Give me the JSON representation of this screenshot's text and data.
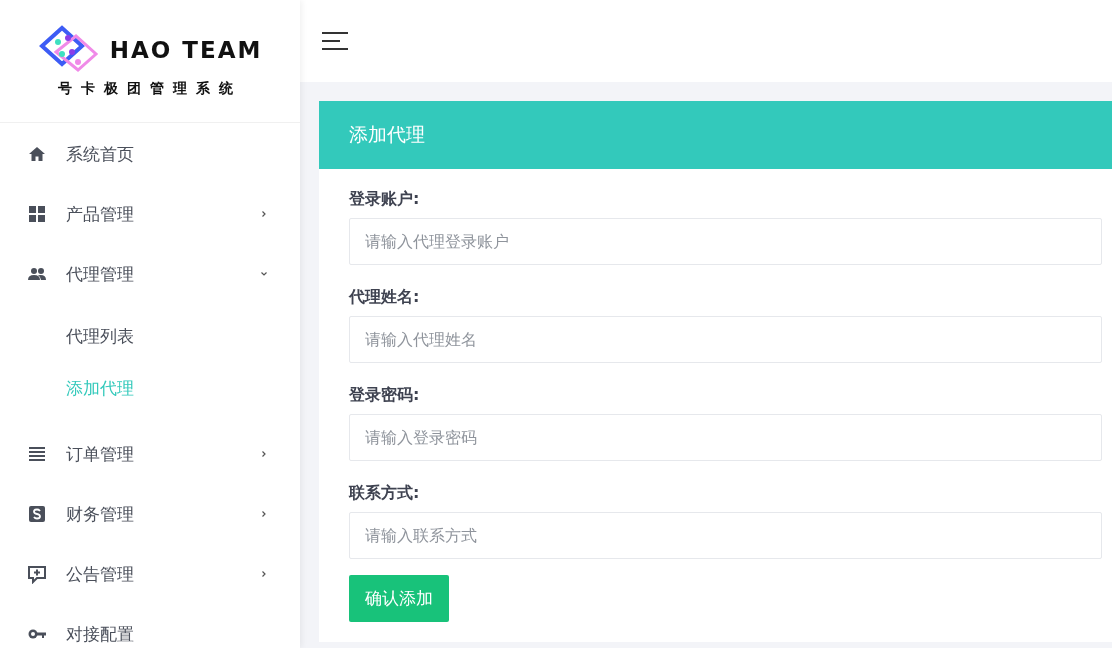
{
  "logo": {
    "name": "HAO TEAM",
    "subtitle": "号卡极团管理系统"
  },
  "sidebar": {
    "items": [
      {
        "label": "系统首页",
        "expandable": false
      },
      {
        "label": "产品管理",
        "expandable": true,
        "expanded": false
      },
      {
        "label": "代理管理",
        "expandable": true,
        "expanded": true,
        "children": [
          {
            "label": "代理列表",
            "selected": false
          },
          {
            "label": "添加代理",
            "selected": true
          }
        ]
      },
      {
        "label": "订单管理",
        "expandable": true,
        "expanded": false
      },
      {
        "label": "财务管理",
        "expandable": true,
        "expanded": false
      },
      {
        "label": "公告管理",
        "expandable": true,
        "expanded": false
      },
      {
        "label": "对接配置",
        "expandable": false
      }
    ]
  },
  "card": {
    "title": "添加代理",
    "fields": [
      {
        "label": "登录账户:",
        "placeholder": "请输入代理登录账户"
      },
      {
        "label": "代理姓名:",
        "placeholder": "请输入代理姓名"
      },
      {
        "label": "登录密码:",
        "placeholder": "请输入登录密码"
      },
      {
        "label": "联系方式:",
        "placeholder": "请输入联系方式"
      }
    ],
    "submit": "确认添加"
  }
}
